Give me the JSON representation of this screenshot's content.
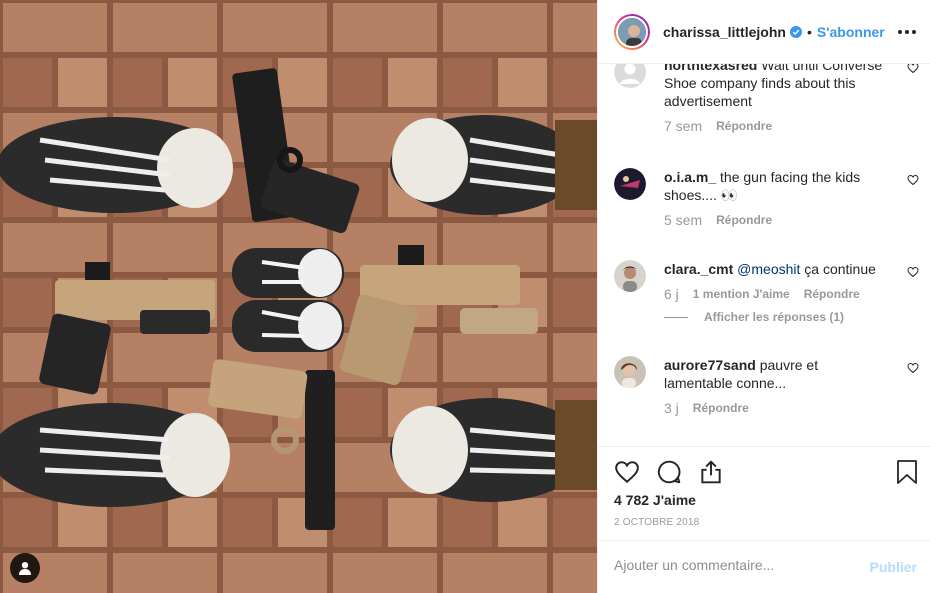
{
  "post": {
    "username": "charissa_littlejohn",
    "separator": "•",
    "follow_label": "S'abonner",
    "verified": true
  },
  "comments": [
    {
      "username": "northtexasred",
      "text": "Wait until Converse Shoe company finds about this advertisement",
      "time": "7 sem",
      "reply_label": "Répondre"
    },
    {
      "username": "o.i.a.m_",
      "text": "the gun facing the kids shoes.... 👀",
      "time": "5 sem",
      "reply_label": "Répondre"
    },
    {
      "username": "clara._cmt",
      "mention": "@meoshit",
      "text": "ça continue",
      "time": "6 j",
      "likes_label": "1 mention J'aime",
      "reply_label": "Répondre",
      "view_replies": "Afficher les réponses (1)"
    },
    {
      "username": "aurore77sand",
      "text": "pauvre et lamentable conne...",
      "time": "3 j",
      "reply_label": "Répondre"
    }
  ],
  "actions": {
    "likes": "4 782 J'aime",
    "date": "2 OCTOBRE 2018"
  },
  "composer": {
    "placeholder": "Ajouter un commentaire...",
    "publish_label": "Publier"
  },
  "colors": {
    "link_blue": "#3897f0",
    "publish_disabled": "#b3dbff",
    "muted": "#999999"
  }
}
